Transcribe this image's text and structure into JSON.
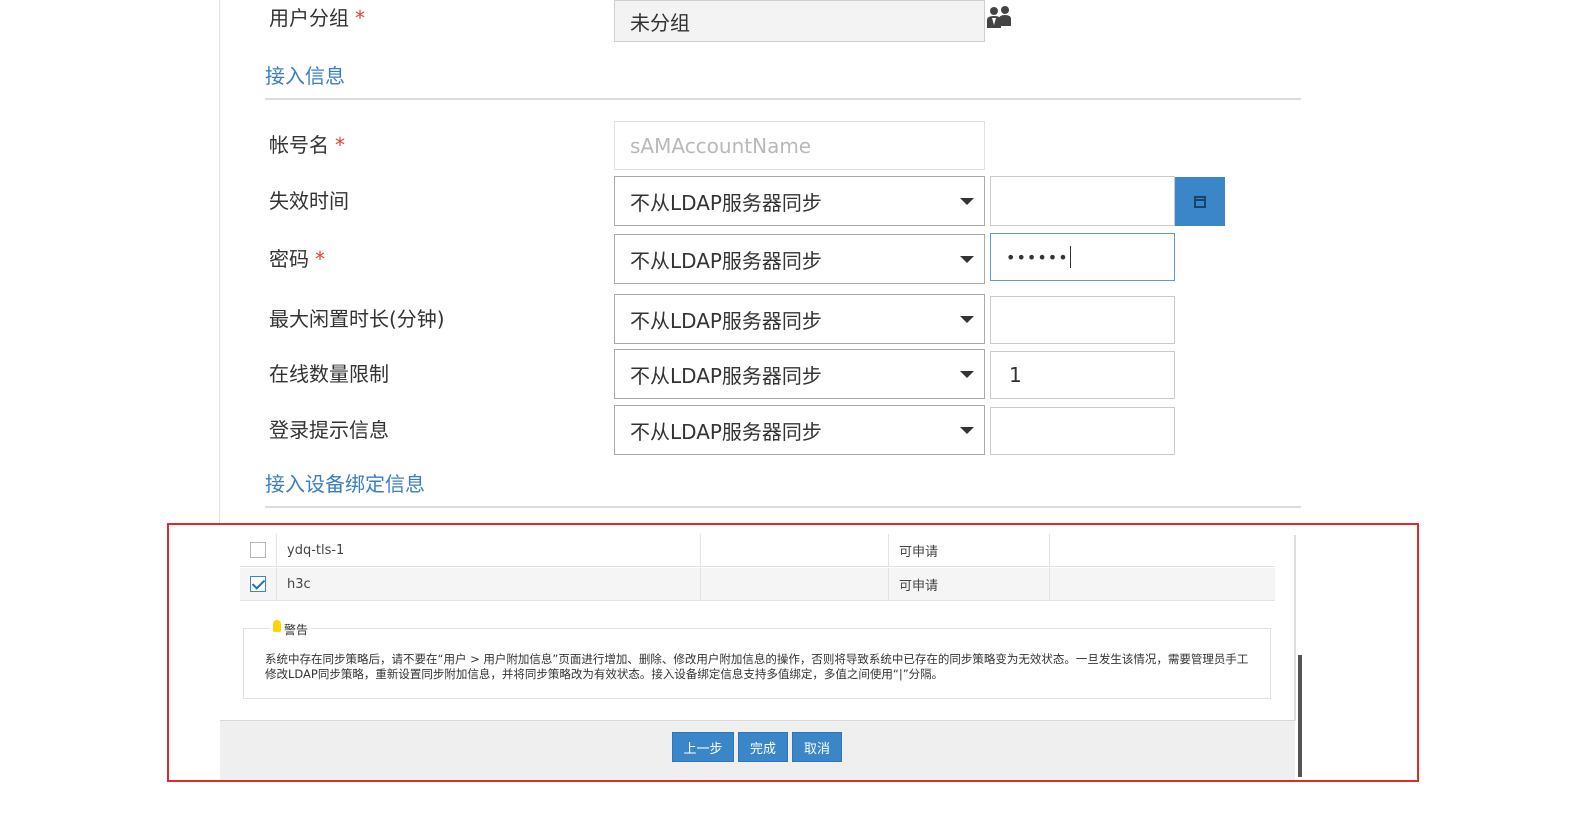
{
  "form": {
    "user_group": {
      "label": "用户分组",
      "required_mark": "*",
      "value": "未分组",
      "icon": "user-group-icon"
    },
    "access_section_title": "接入信息",
    "account_name": {
      "label": "帐号名",
      "required_mark": "*",
      "placeholder": "sAMAccountName"
    },
    "expire_time": {
      "label": "失效时间",
      "select_value": "不从LDAP服务器同步",
      "input_value": "",
      "icon": "calendar-icon"
    },
    "password": {
      "label": "密码",
      "required_mark": "*",
      "select_value": "不从LDAP服务器同步",
      "input_value": "••••••"
    },
    "max_idle": {
      "label": "最大闲置时长(分钟)",
      "select_value": "不从LDAP服务器同步",
      "input_value": ""
    },
    "online_limit": {
      "label": "在线数量限制",
      "select_value": "不从LDAP服务器同步",
      "input_value": "1"
    },
    "login_hint": {
      "label": "登录提示信息",
      "select_value": "不从LDAP服务器同步",
      "input_value": ""
    },
    "device_binding_section_title": "接入设备绑定信息"
  },
  "table": {
    "rows": [
      {
        "name": "ydq-tls-1",
        "status": "可申请",
        "checked": false
      },
      {
        "name": "h3c",
        "status": "可申请",
        "checked": true
      }
    ]
  },
  "warning": {
    "title": "警告",
    "text": "系统中存在同步策略后，请不要在“用户 > 用户附加信息”页面进行增加、删除、修改用户附加信息的操作，否则将导致系统中已存在的同步策略变为无效状态。一旦发生该情况，需要管理员手工修改LDAP同步策略，重新设置同步附加信息，并将同步策略改为有效状态。接入设备绑定信息支持多值绑定，多值之间使用“|”分隔。"
  },
  "buttons": {
    "prev": "上一步",
    "finish": "完成",
    "cancel": "取消"
  },
  "colors": {
    "accent": "#3b86c9",
    "section_title": "#3a7ec4",
    "required": "#d9413a",
    "highlight_box": "#e12a2a"
  }
}
